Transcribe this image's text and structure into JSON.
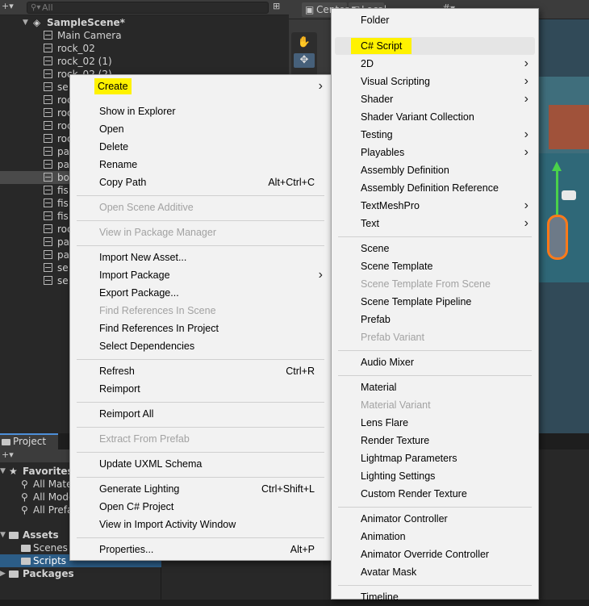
{
  "hierarchy": {
    "search_placeholder": "All",
    "scene_name": "SampleScene*",
    "items": [
      "Main Camera",
      "rock_02",
      "rock_02 (1)",
      "rock_02 (2)",
      "se",
      "roc",
      "roc",
      "roc",
      "roc",
      "pa",
      "pa",
      "bo",
      "fis",
      "fis",
      "fis",
      "roc",
      "pa",
      "pa",
      "se",
      "se"
    ]
  },
  "scene": {
    "center_label": "Center",
    "local_label": "Local"
  },
  "project": {
    "tab_label": "Project",
    "favorites_label": "Favorites",
    "favorites": [
      "All Mate",
      "All Mode",
      "All Prefa"
    ],
    "assets_label": "Assets",
    "assets_children": [
      "Scenes",
      "Scripts"
    ],
    "packages_label": "Packages"
  },
  "context_menu": {
    "items": [
      {
        "label": "Create",
        "shortcut": "",
        "submenu": true,
        "disabled": false,
        "highlight": true
      },
      {
        "label": "Show in Explorer",
        "shortcut": "",
        "submenu": false,
        "disabled": false
      },
      {
        "label": "Open",
        "shortcut": "",
        "submenu": false,
        "disabled": false
      },
      {
        "label": "Delete",
        "shortcut": "",
        "submenu": false,
        "disabled": false
      },
      {
        "label": "Rename",
        "shortcut": "",
        "submenu": false,
        "disabled": false
      },
      {
        "label": "Copy Path",
        "shortcut": "Alt+Ctrl+C",
        "submenu": false,
        "disabled": false
      },
      {
        "label": "Open Scene Additive",
        "shortcut": "",
        "submenu": false,
        "disabled": true
      },
      {
        "label": "View in Package Manager",
        "shortcut": "",
        "submenu": false,
        "disabled": true
      },
      {
        "label": "Import New Asset...",
        "shortcut": "",
        "submenu": false,
        "disabled": false
      },
      {
        "label": "Import Package",
        "shortcut": "",
        "submenu": true,
        "disabled": false
      },
      {
        "label": "Export Package...",
        "shortcut": "",
        "submenu": false,
        "disabled": false
      },
      {
        "label": "Find References In Scene",
        "shortcut": "",
        "submenu": false,
        "disabled": true
      },
      {
        "label": "Find References In Project",
        "shortcut": "",
        "submenu": false,
        "disabled": false
      },
      {
        "label": "Select Dependencies",
        "shortcut": "",
        "submenu": false,
        "disabled": false
      },
      {
        "label": "Refresh",
        "shortcut": "Ctrl+R",
        "submenu": false,
        "disabled": false
      },
      {
        "label": "Reimport",
        "shortcut": "",
        "submenu": false,
        "disabled": false
      },
      {
        "label": "Reimport All",
        "shortcut": "",
        "submenu": false,
        "disabled": false
      },
      {
        "label": "Extract From Prefab",
        "shortcut": "",
        "submenu": false,
        "disabled": true
      },
      {
        "label": "Update UXML Schema",
        "shortcut": "",
        "submenu": false,
        "disabled": false
      },
      {
        "label": "Generate Lighting",
        "shortcut": "Ctrl+Shift+L",
        "submenu": false,
        "disabled": false
      },
      {
        "label": "Open C# Project",
        "shortcut": "",
        "submenu": false,
        "disabled": false
      },
      {
        "label": "View in Import Activity Window",
        "shortcut": "",
        "submenu": false,
        "disabled": false
      },
      {
        "label": "Properties...",
        "shortcut": "Alt+P",
        "submenu": false,
        "disabled": false
      }
    ]
  },
  "create_submenu": {
    "items": [
      {
        "label": "Folder",
        "submenu": false,
        "disabled": false
      },
      {
        "label": "C# Script",
        "submenu": false,
        "disabled": false,
        "highlight": true
      },
      {
        "label": "2D",
        "submenu": true,
        "disabled": false
      },
      {
        "label": "Visual Scripting",
        "submenu": true,
        "disabled": false
      },
      {
        "label": "Shader",
        "submenu": true,
        "disabled": false
      },
      {
        "label": "Shader Variant Collection",
        "submenu": false,
        "disabled": false
      },
      {
        "label": "Testing",
        "submenu": true,
        "disabled": false
      },
      {
        "label": "Playables",
        "submenu": true,
        "disabled": false
      },
      {
        "label": "Assembly Definition",
        "submenu": false,
        "disabled": false
      },
      {
        "label": "Assembly Definition Reference",
        "submenu": false,
        "disabled": false
      },
      {
        "label": "TextMeshPro",
        "submenu": true,
        "disabled": false
      },
      {
        "label": "Text",
        "submenu": true,
        "disabled": false
      },
      {
        "label": "Scene",
        "submenu": false,
        "disabled": false
      },
      {
        "label": "Scene Template",
        "submenu": false,
        "disabled": false
      },
      {
        "label": "Scene Template From Scene",
        "submenu": false,
        "disabled": true
      },
      {
        "label": "Scene Template Pipeline",
        "submenu": false,
        "disabled": false
      },
      {
        "label": "Prefab",
        "submenu": false,
        "disabled": false
      },
      {
        "label": "Prefab Variant",
        "submenu": false,
        "disabled": true
      },
      {
        "label": "Audio Mixer",
        "submenu": false,
        "disabled": false
      },
      {
        "label": "Material",
        "submenu": false,
        "disabled": false
      },
      {
        "label": "Material Variant",
        "submenu": false,
        "disabled": true
      },
      {
        "label": "Lens Flare",
        "submenu": false,
        "disabled": false
      },
      {
        "label": "Render Texture",
        "submenu": false,
        "disabled": false
      },
      {
        "label": "Lightmap Parameters",
        "submenu": false,
        "disabled": false
      },
      {
        "label": "Lighting Settings",
        "submenu": false,
        "disabled": false
      },
      {
        "label": "Custom Render Texture",
        "submenu": false,
        "disabled": false
      },
      {
        "label": "Animator Controller",
        "submenu": false,
        "disabled": false
      },
      {
        "label": "Animation",
        "submenu": false,
        "disabled": false
      },
      {
        "label": "Animator Override Controller",
        "submenu": false,
        "disabled": false
      },
      {
        "label": "Avatar Mask",
        "submenu": false,
        "disabled": false
      },
      {
        "label": "Timeline",
        "submenu": false,
        "disabled": false
      }
    ]
  },
  "colors": {
    "highlight": "#fff200",
    "selection": "#2c5d87",
    "menu_bg": "#f2f2f2",
    "disabled_text": "#a2a2a2"
  }
}
